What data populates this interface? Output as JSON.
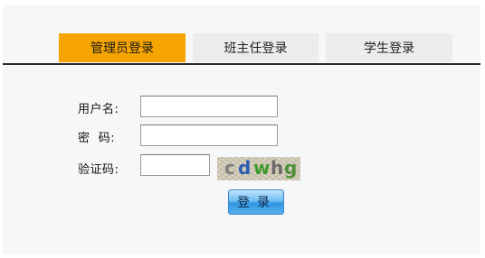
{
  "tabs": {
    "admin": "管理员登录",
    "teacher": "班主任登录",
    "student": "学生登录"
  },
  "form": {
    "username_label": "用户名:",
    "password_label": "密  码:",
    "captcha_label": "验证码:",
    "username_value": "",
    "password_value": "",
    "captcha_value": ""
  },
  "captcha": {
    "chars": [
      "c",
      "d",
      "w",
      "h",
      "g"
    ]
  },
  "login_button": "登录",
  "colors": {
    "active_tab": "#f5a400",
    "inactive_tab": "#ececec",
    "captcha_char_colors": [
      "#7d7d7d",
      "#2a5db0",
      "#3e9a2c",
      "#6a6a6a",
      "#4e8f3a"
    ]
  }
}
